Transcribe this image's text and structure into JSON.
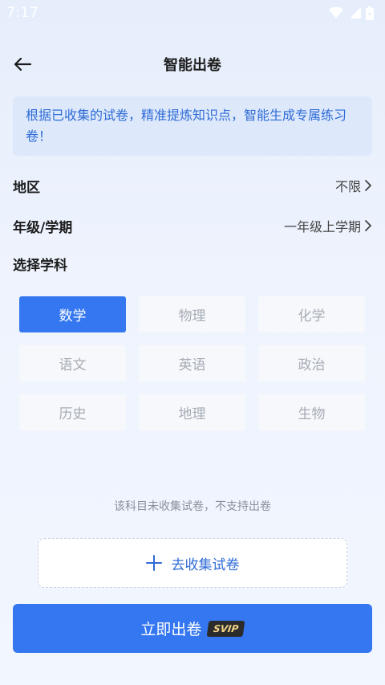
{
  "status_bar": {
    "time": "7:17"
  },
  "header": {
    "title": "智能出卷"
  },
  "notice": {
    "text": "根据已收集的试卷，精准提炼知识点，智能生成专属练习卷！"
  },
  "filters": {
    "region": {
      "label": "地区",
      "value": "不限"
    },
    "grade": {
      "label": "年级/学期",
      "value": "一年级上学期"
    }
  },
  "subjects": {
    "title": "选择学科",
    "selected": "数学",
    "items": [
      "数学",
      "物理",
      "化学",
      "语文",
      "英语",
      "政治",
      "历史",
      "地理",
      "生物"
    ]
  },
  "hint": "该科目未收集试卷，不支持出卷",
  "collect_button": {
    "label": "去收集试卷"
  },
  "primary_button": {
    "label": "立即出卷",
    "badge": "SVIP"
  },
  "colors": {
    "accent": "#3477f0",
    "notice_bg": "#dde9fb",
    "badge_bg": "#2b2b2b"
  }
}
